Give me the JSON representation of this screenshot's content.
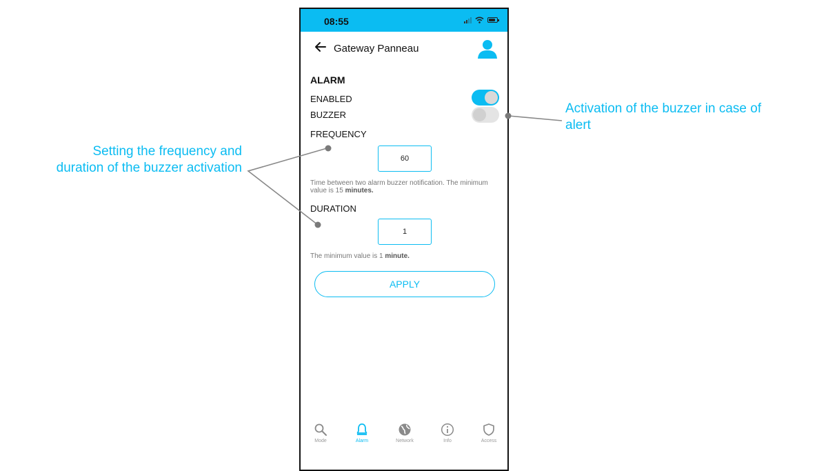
{
  "status_bar": {
    "time": "08:55"
  },
  "header": {
    "title": "Gateway Panneau"
  },
  "alarm": {
    "section_title": "ALARM",
    "enabled_label": "ENABLED",
    "enabled": true,
    "buzzer_label": "BUZZER",
    "buzzer": false,
    "frequency": {
      "label": "FREQUENCY",
      "value": "60",
      "help_text": "Time between two alarm buzzer notification. The minimum value is 15 ",
      "help_emphasis": "minutes."
    },
    "duration": {
      "label": "DURATION",
      "value": "1",
      "help_text": "The minimum value is 1 ",
      "help_emphasis": "minute."
    },
    "apply_label": "APPLY"
  },
  "tabs": [
    {
      "label": "Mode",
      "icon": "search-icon",
      "active": false
    },
    {
      "label": "Alarm",
      "icon": "bell-icon",
      "active": true
    },
    {
      "label": "Network",
      "icon": "globe-icon",
      "active": false
    },
    {
      "label": "Info",
      "icon": "info-icon",
      "active": false
    },
    {
      "label": "Access",
      "icon": "shield-icon",
      "active": false
    }
  ],
  "annotations": {
    "left_line1": "Setting the frequency and",
    "left_line2": "duration of the buzzer activation",
    "right_line1": "Activation of the buzzer in case of",
    "right_line2": "alert"
  },
  "colors": {
    "accent": "#0bbcf2",
    "toggle_off": "#e4e4e4",
    "frame": "#111111"
  }
}
